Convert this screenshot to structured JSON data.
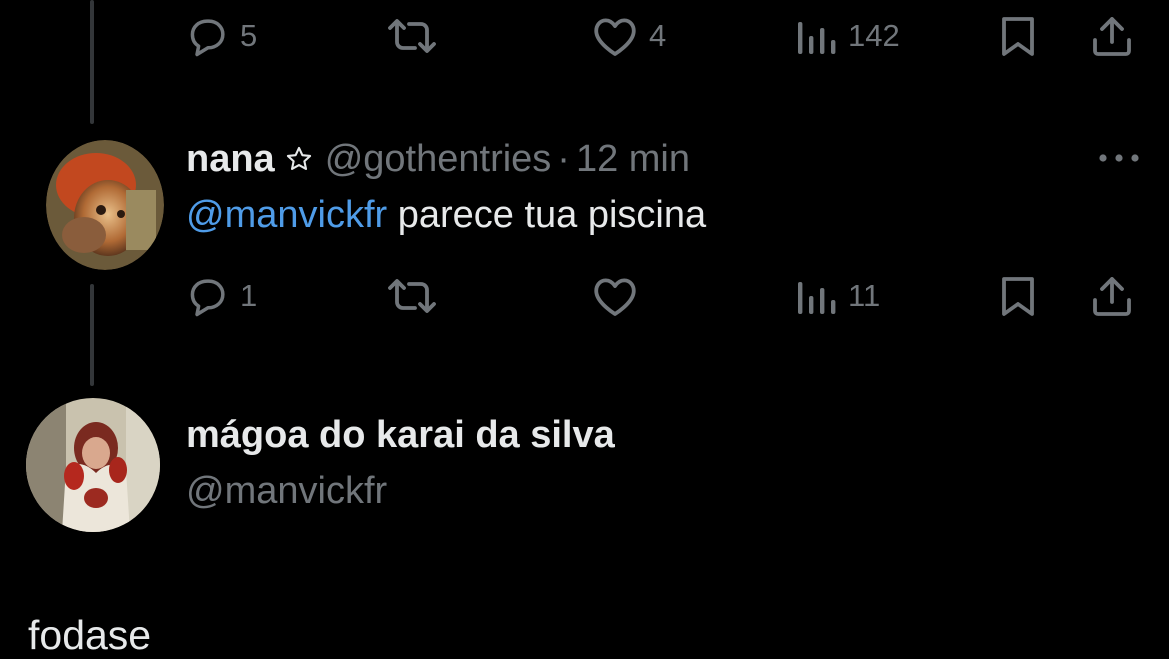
{
  "colors": {
    "background": "#000000",
    "primary_text": "#e7e9ea",
    "secondary_text": "#71767b",
    "mention": "#4f9ce8",
    "thread_line": "#333639"
  },
  "top_tweet_actions": {
    "replies": "5",
    "likes": "4",
    "views": "142",
    "icons": [
      "reply-icon",
      "retweet-icon",
      "like-icon",
      "views-icon",
      "bookmark-icon",
      "share-icon"
    ]
  },
  "reply_tweet": {
    "display_name": "nana",
    "badge_icon": "star-icon",
    "handle": "@gothentries",
    "separator": "·",
    "time": "12 min",
    "mention": "@manvickfr",
    "text": " parece tua piscina",
    "actions": {
      "replies": "1",
      "views": "11"
    }
  },
  "main_tweet": {
    "display_name": "mágoa do karai da silva",
    "handle": "@manvickfr",
    "text": "fodase"
  }
}
